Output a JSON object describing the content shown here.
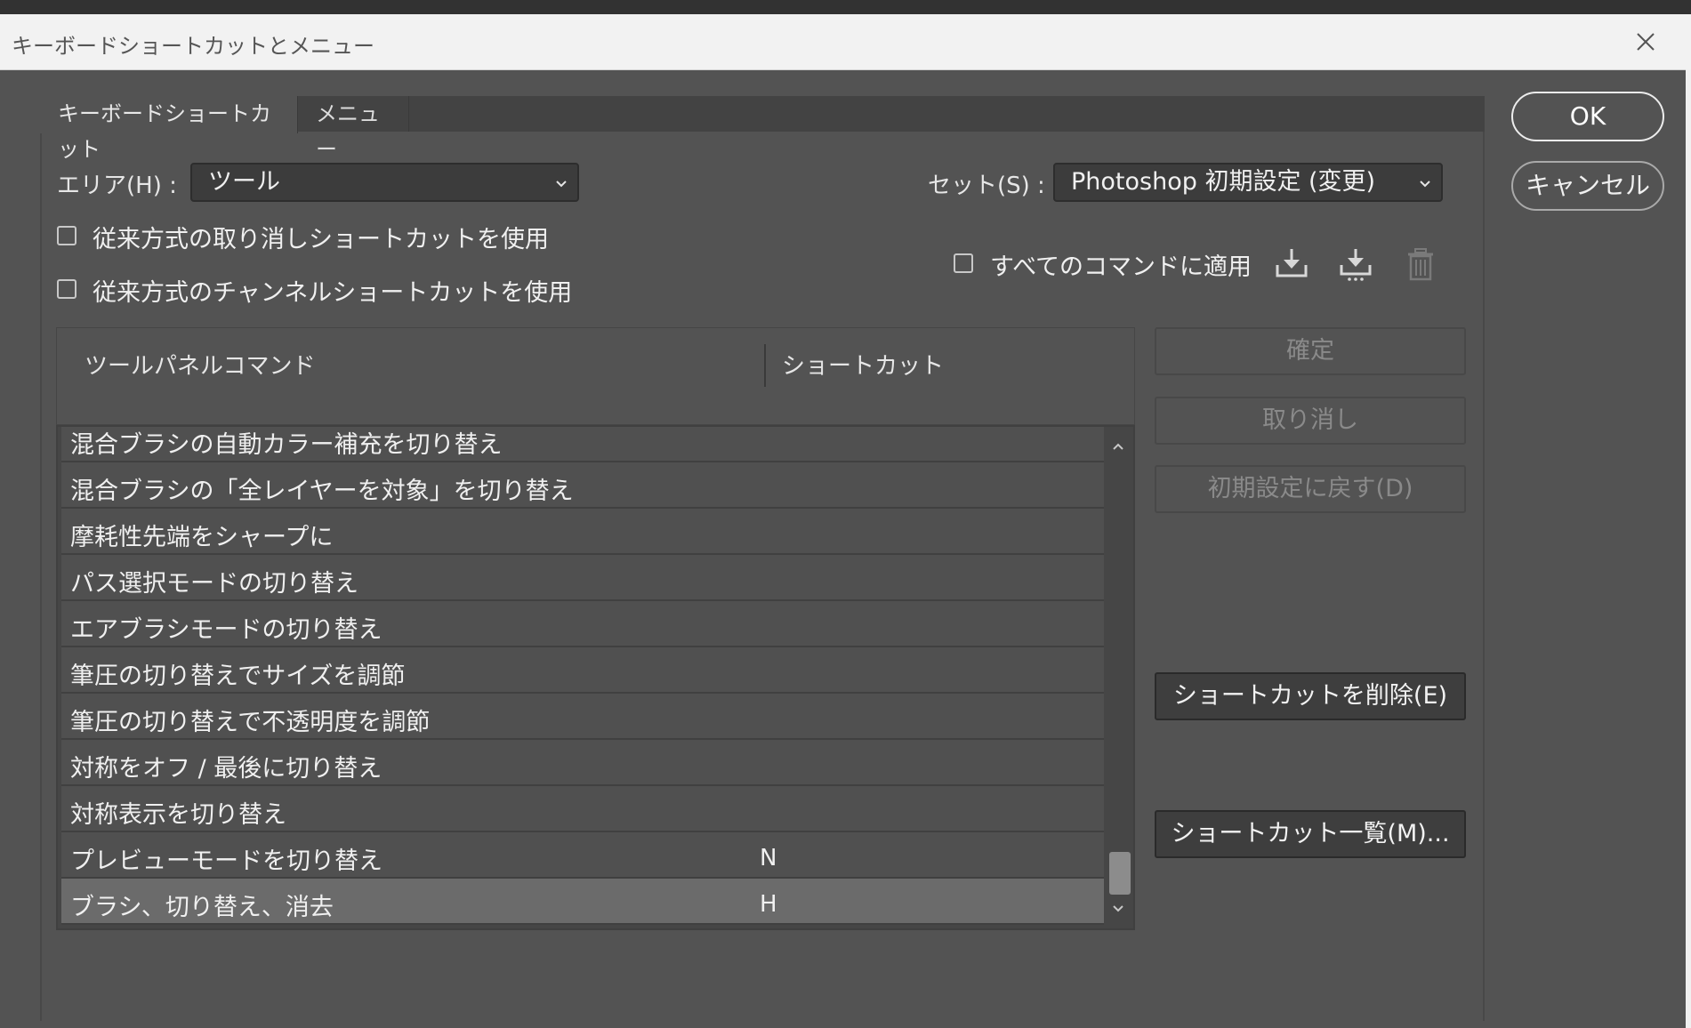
{
  "window": {
    "title": "キーボードショートカットとメニュー"
  },
  "tabs": [
    {
      "label": "キーボードショートカット",
      "active": true
    },
    {
      "label": "メニュー",
      "active": false
    }
  ],
  "area": {
    "label": "エリア(H) :",
    "value": "ツール"
  },
  "set": {
    "label": "セット(S) :",
    "value": "Photoshop 初期設定 (変更)"
  },
  "options": {
    "legacy_undo": "従来方式の取り消しショートカットを使用",
    "legacy_channel": "従来方式のチャンネルショートカットを使用",
    "apply_all": "すべてのコマンドに適用"
  },
  "icons": {
    "save": "save-set-icon",
    "save_as": "save-set-as-icon",
    "delete": "trash-icon"
  },
  "table": {
    "col_command": "ツールパネルコマンド",
    "col_shortcut": "ショートカット",
    "rows": [
      {
        "command": "混合ブラシの自動カラー補充を切り替え",
        "shortcut": ""
      },
      {
        "command": "混合ブラシの「全レイヤーを対象」を切り替え",
        "shortcut": ""
      },
      {
        "command": "摩耗性先端をシャープに",
        "shortcut": ""
      },
      {
        "command": "パス選択モードの切り替え",
        "shortcut": ""
      },
      {
        "command": "エアブラシモードの切り替え",
        "shortcut": ""
      },
      {
        "command": "筆圧の切り替えでサイズを調節",
        "shortcut": ""
      },
      {
        "command": "筆圧の切り替えで不透明度を調節",
        "shortcut": ""
      },
      {
        "command": "対称をオフ / 最後に切り替え",
        "shortcut": ""
      },
      {
        "command": "対称表示を切り替え",
        "shortcut": ""
      },
      {
        "command": "プレビューモードを切り替え",
        "shortcut": "N"
      },
      {
        "command": "ブラシ、切り替え、消去",
        "shortcut": "H"
      }
    ],
    "selected_index": 10
  },
  "side_buttons": {
    "accept": "確定",
    "undo": "取り消し",
    "use_default": "初期設定に戻す(D)",
    "delete_shortcut": "ショートカットを削除(E)",
    "summarize": "ショートカット一覧(M)..."
  },
  "dialog_buttons": {
    "ok": "OK",
    "cancel": "キャンセル"
  },
  "colors": {
    "dialog_bg": "#535353",
    "titlebar_bg": "#f2f2f2",
    "selected_row": "#6b6b6b"
  }
}
